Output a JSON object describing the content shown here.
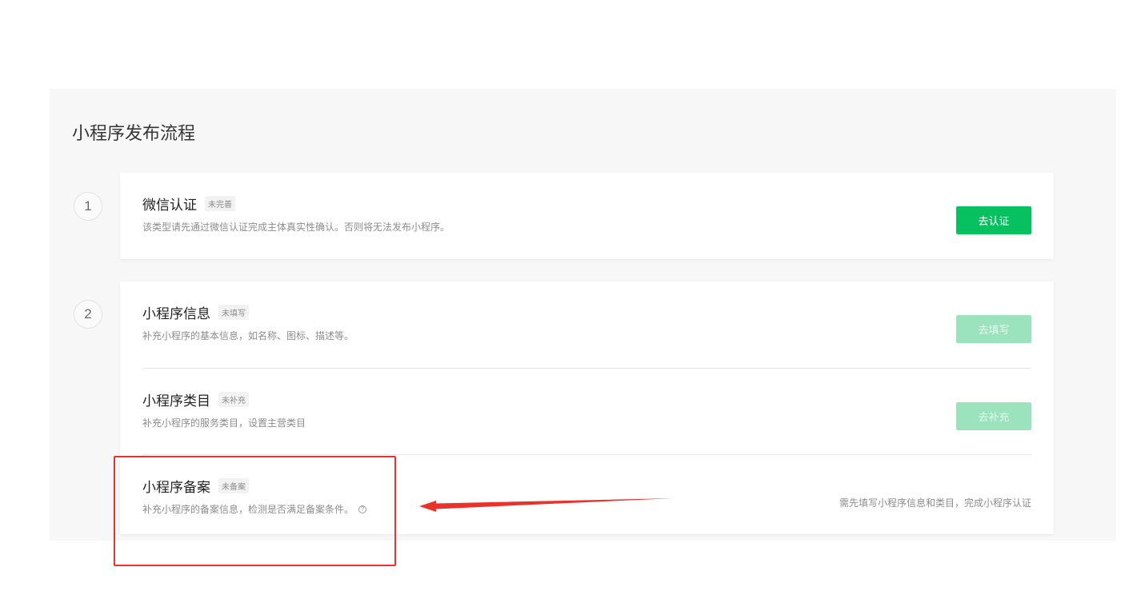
{
  "section": {
    "title": "小程序发布流程"
  },
  "steps": [
    {
      "number": "1",
      "items": [
        {
          "title": "微信认证",
          "tag": "未完善",
          "description": "该类型请先通过微信认证完成主体真实性确认。否则将无法发布小程序。",
          "button": "去认证",
          "button_state": "enabled"
        }
      ]
    },
    {
      "number": "2",
      "items": [
        {
          "title": "小程序信息",
          "tag": "未填写",
          "description": "补充小程序的基本信息，如名称、图标、描述等。",
          "button": "去填写",
          "button_state": "disabled"
        },
        {
          "title": "小程序类目",
          "tag": "未补充",
          "description": "补充小程序的服务类目，设置主营类目",
          "button": "去补充",
          "button_state": "disabled"
        },
        {
          "title": "小程序备案",
          "tag": "未备案",
          "description": "补充小程序的备案信息，检测是否满足备案条件。",
          "note": "需先填写小程序信息和类目，完成小程序认证",
          "help_icon": "help-circle-icon"
        }
      ]
    }
  ],
  "colors": {
    "primary": "#07c160",
    "primary_disabled": "#9be3bd",
    "annotation": "#e8322a"
  }
}
